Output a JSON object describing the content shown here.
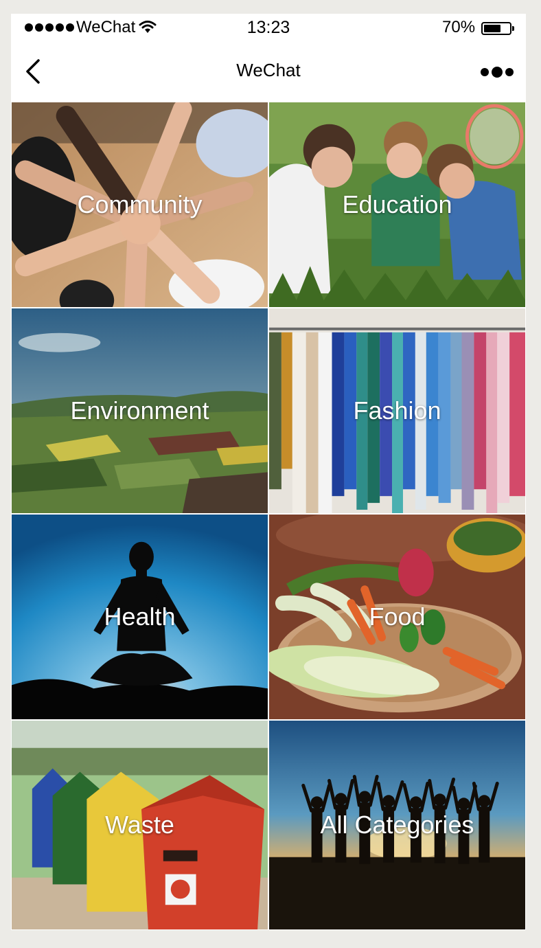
{
  "status_bar": {
    "carrier": "WeChat",
    "time": "13:23",
    "battery": "70%",
    "battery_level": 0.7,
    "signal_icon": "signal-dots-icon",
    "wifi_icon": "wifi-icon"
  },
  "nav": {
    "title": "WeChat",
    "back_icon": "back-chevron-icon",
    "more_icon": "more-dots-icon"
  },
  "categories": [
    {
      "label": "Community",
      "theme": "hands-stacked"
    },
    {
      "label": "Education",
      "theme": "kids-in-grass"
    },
    {
      "label": "Environment",
      "theme": "farmland-landscape"
    },
    {
      "label": "Fashion",
      "theme": "clothes-rack"
    },
    {
      "label": "Health",
      "theme": "meditation-silhouette"
    },
    {
      "label": "Food",
      "theme": "vegetable-basket"
    },
    {
      "label": "Waste",
      "theme": "recycling-bins"
    },
    {
      "label": "All Categories",
      "theme": "people-sunset"
    }
  ]
}
